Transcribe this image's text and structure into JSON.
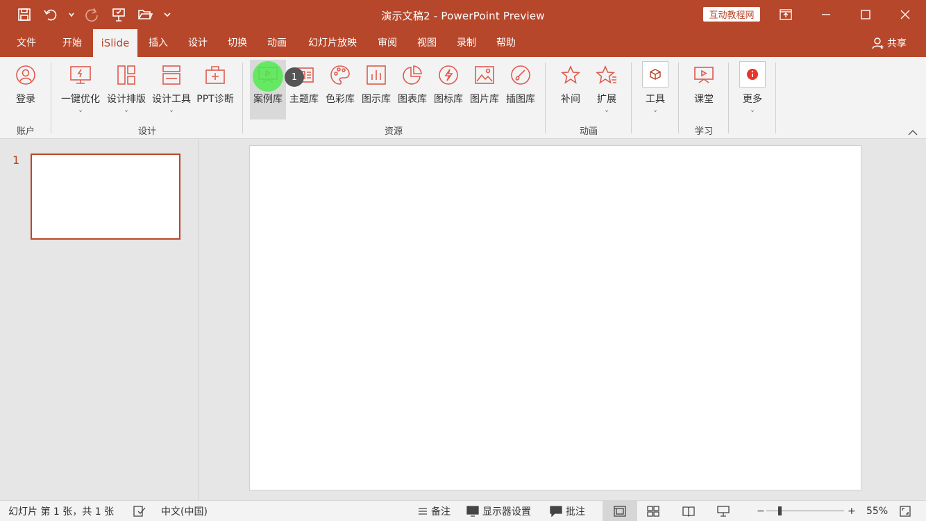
{
  "titlebar": {
    "title": "演示文稿2  -  PowerPoint Preview",
    "brand": "互动教程网",
    "qat_icons": [
      "save-icon",
      "undo-icon",
      "redo-icon",
      "presenter-icon",
      "open-folder-icon",
      "customize-icon"
    ],
    "window_buttons": [
      "ribbon-display-icon",
      "minimize-icon",
      "maximize-icon",
      "close-icon"
    ]
  },
  "tabs": [
    "文件",
    "开始",
    "iSlide",
    "插入",
    "设计",
    "切换",
    "动画",
    "幻灯片放映",
    "审阅",
    "视图",
    "录制",
    "帮助"
  ],
  "active_tab": "iSlide",
  "share_label": "共享",
  "ribbon": {
    "groups": {
      "account": "账户",
      "design": "设计",
      "resources": "资源",
      "animation": "动画",
      "learn": "学习"
    },
    "buttons": {
      "login": "登录",
      "optimize": "一键优化",
      "layout": "设计排版",
      "design_tools": "设计工具",
      "ppt_diag": "PPT诊断",
      "cases": "案例库",
      "themes": "主题库",
      "colors": "色彩库",
      "diagrams": "图示库",
      "charts": "图表库",
      "icons": "图标库",
      "images": "图片库",
      "illustrations": "插图库",
      "tween": "补间",
      "extend": "扩展",
      "tools": "工具",
      "classroom": "课堂",
      "more": "更多"
    },
    "hover_badge": "1"
  },
  "slides": {
    "count_label": "1"
  },
  "status": {
    "slide_info": "幻灯片 第 1 张，共 1 张",
    "language": "中文(中国)",
    "notes": "备注",
    "display_settings": "显示器设置",
    "comments": "批注",
    "zoom_minus": "−",
    "zoom_plus": "+",
    "zoom": "55%"
  },
  "colors": {
    "accent": "#b7472a",
    "icon_red": "#e05a4e"
  }
}
